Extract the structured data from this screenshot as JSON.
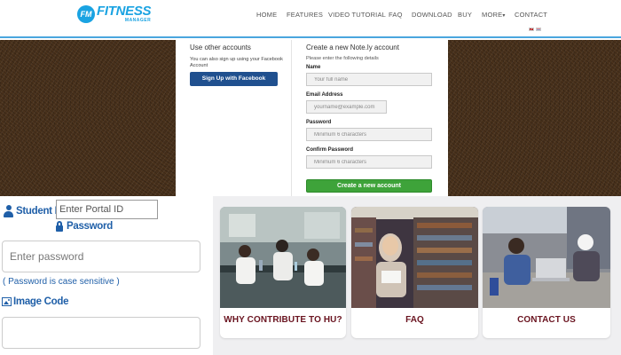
{
  "brand": {
    "mark": "FM",
    "name": "FITNESS",
    "sub": "MANAGER"
  },
  "nav": {
    "items": [
      "HOME",
      "FEATURES",
      "VIDEO TUTORIAL",
      "FAQ",
      "DOWNLOAD",
      "BUY",
      "MORE",
      "CONTACT"
    ],
    "more_caret": "▾"
  },
  "signup": {
    "other_heading": "Use other accounts",
    "other_note": "You can also sign up using your Facebook Account",
    "facebook_button": "Sign Up with Facebook",
    "new_heading": "Create a new Note.ly account",
    "new_note": "Please enter the following details",
    "name_label": "Name",
    "name_placeholder": "Your full name",
    "email_label": "Email Address",
    "email_placeholder": "yourname@example.com",
    "password_label": "Password",
    "password_placeholder": "Minimum 6 characters",
    "confirm_label": "Confirm Password",
    "confirm_placeholder": "Minimum 6 characters",
    "create_button": "Create a new account"
  },
  "login": {
    "student_id_label": "Student ID",
    "portal_placeholder": "Enter Portal ID",
    "password_label": "Password",
    "password_placeholder": "Enter password",
    "password_note": "( Password is case sensitive )",
    "image_code_label": "Image Code"
  },
  "cards": [
    {
      "title": "WHY CONTRIBUTE TO HU?",
      "photo": "lab-students"
    },
    {
      "title": "FAQ",
      "photo": "library-student"
    },
    {
      "title": "CONTACT US",
      "photo": "students-laptop"
    }
  ],
  "colors": {
    "brand_blue": "#1aa3e2",
    "facebook_blue": "#20508f",
    "create_green": "#3ea33a",
    "label_blue": "#1f5fa8",
    "card_title": "#6a1420"
  }
}
